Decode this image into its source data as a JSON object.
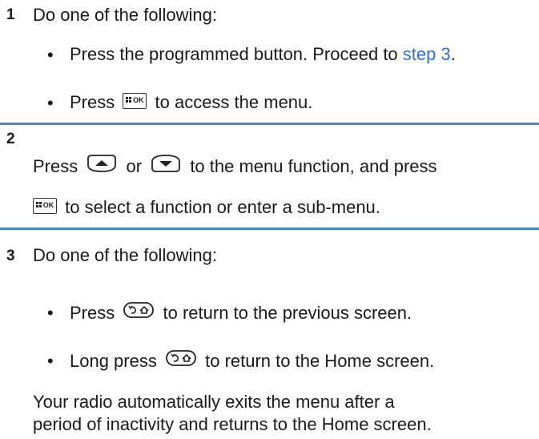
{
  "step1": {
    "number": "1",
    "intro": "Do one of the following:",
    "bullet_char": "•",
    "option_a_text": "Press the programmed button. Proceed to ",
    "option_a_link": "step 3",
    "option_a_end": ".",
    "option_b_before": "Press",
    "option_b_after": "to access the menu."
  },
  "step2": {
    "number": "2",
    "line1_press": "Press",
    "line1_or": "or",
    "line1_after": "to the menu function, and press",
    "line2_after": "to select a function or enter a sub-menu."
  },
  "step3": {
    "number": "3",
    "intro": "Do one of the following:",
    "bullet_char": "•",
    "option_a_before": "Press",
    "option_a_after": "to return to the previous screen.",
    "option_b_before": "Long press",
    "option_b_after": "to return to the Home screen.",
    "note_line1": "Your radio automatically exits the menu after a",
    "note_line2": "period of inactivity and returns to the Home screen."
  },
  "keys": {
    "ok_label": "OK",
    "ok_icon": "menu-ok-key-icon",
    "up_icon": "up-arrow-key-icon",
    "down_icon": "down-arrow-key-icon",
    "back_home_icon": "back-home-key-icon"
  },
  "colors": {
    "rule": "#4a86c0",
    "link": "#2f6fd6"
  }
}
